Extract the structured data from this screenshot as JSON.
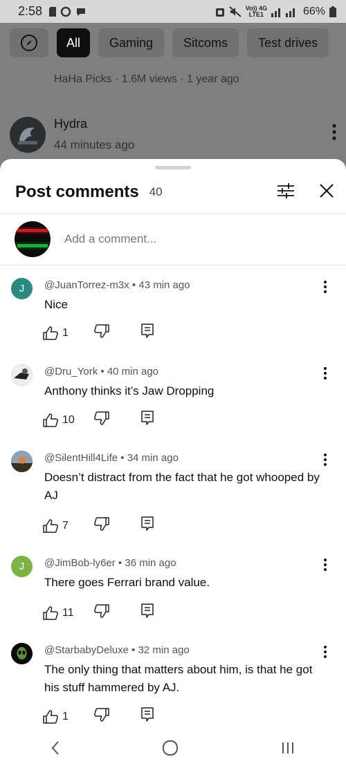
{
  "status_bar": {
    "time": "2:58",
    "network_top": "Vo)) 4G",
    "network_bottom": "LTE1",
    "battery": "66%"
  },
  "background": {
    "chips": [
      "All",
      "Gaming",
      "Sitcoms",
      "Test drives"
    ],
    "meta": "HaHa Picks · 1.6M views · 1 year ago",
    "channel": "Hydra",
    "posted": "44 minutes ago"
  },
  "sheet": {
    "title": "Post comments",
    "count": "40",
    "add_comment_placeholder": "Add a comment..."
  },
  "comments": [
    {
      "avatar_letter": "J",
      "avatar_color": "#2a8a80",
      "author": "@JuanTorrez-m3x",
      "time": "43 min ago",
      "text": "Nice",
      "likes": "1"
    },
    {
      "avatar_letter": "",
      "avatar_color": "#3a3a3a",
      "author": "@Dru_York",
      "time": "40 min ago",
      "text": "Anthony thinks it’s Jaw Dropping",
      "likes": "10"
    },
    {
      "avatar_letter": "",
      "avatar_color": "#4a5560",
      "author": "@SilentHill4Life",
      "time": "34 min ago",
      "text": "Doesn’t distract from the fact that he got whooped by AJ",
      "likes": "7"
    },
    {
      "avatar_letter": "J",
      "avatar_color": "#7cb342",
      "author": "@JimBob-ly6er",
      "time": "36 min ago",
      "text": "There goes Ferrari brand value.",
      "likes": "11"
    },
    {
      "avatar_letter": "",
      "avatar_color": "#0a0a0a",
      "author": "@StarbabyDeluxe",
      "time": "32 min ago",
      "text": "The only thing that matters about him, is that he got his stuff hammered by AJ.",
      "likes": "1"
    }
  ]
}
